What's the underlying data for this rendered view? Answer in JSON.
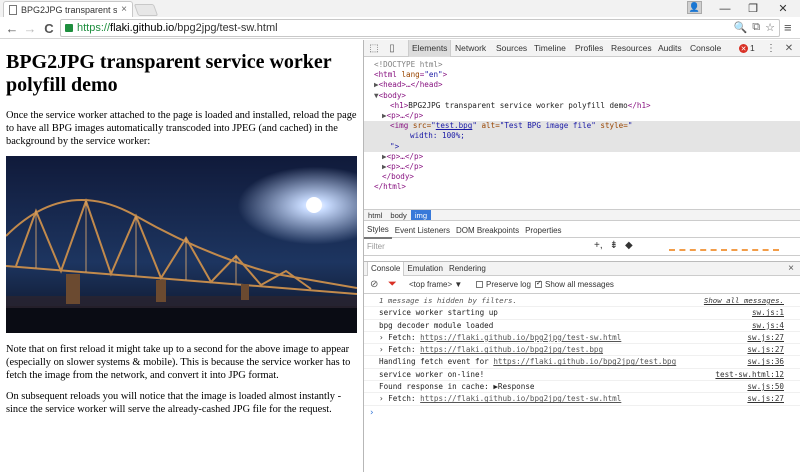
{
  "browser": {
    "tab_title": "BPG2JPG transparent serv",
    "tab_close": "×",
    "url_scheme": "https://",
    "url_host": "flaki.github.io",
    "url_path": "/bpg2jpg/test-sw.html",
    "nav": {
      "back": "←",
      "forward": "→",
      "reload": "C"
    },
    "window": {
      "minimize": "—",
      "maximize": "❐",
      "close": "✕"
    }
  },
  "page": {
    "heading": "BPG2JPG transparent service worker polyfill demo",
    "para1": "Once the service worker attached to the page is loaded and installed, reload the page to have all BPG images automatically transcoded into JPEG (and cached) in the background by the service worker:",
    "para2": "Note that on first reload it might take up to a second for the above image to appear (especially on slower systems & mobile). This is because the service worker has to fetch the image from the network, and convert it into JPG format.",
    "para3": "On subsequent reloads you will notice that the image is loaded almost instantly - since the service worker will serve the already-cashed JPG file for the request."
  },
  "devtools": {
    "tabs": [
      "Elements",
      "Network",
      "Sources",
      "Timeline",
      "Profiles",
      "Resources",
      "Audits",
      "Console"
    ],
    "active_tab": "Elements",
    "error_count": "1",
    "dom": {
      "doctype": "<!DOCTYPE html>",
      "html_open": "<html",
      "lang_attr": "lang",
      "lang_val": "\"en\"",
      "html_close_bracket": ">",
      "head": "<head>…</head>",
      "body_open": "<body>",
      "h1_open": "<h1>",
      "h1_text": "BPG2JPG transparent service worker polyfill demo",
      "h1_close": "</h1>",
      "p_collapsed": "<p>…</p>",
      "img_open": "<img",
      "src_attr": "src=",
      "src_val": "test.bpg",
      "alt_attr": "alt=",
      "alt_val": "\"Test BPG image file\"",
      "style_attr": "style=",
      "style_q": "\"",
      "style_val": "width: 100%;",
      "style_end": "\">",
      "body_close": "</body>",
      "html_close": "</html>"
    },
    "breadcrumbs": [
      "html",
      "body",
      "img"
    ],
    "style_tabs": [
      "Styles",
      "Event Listeners",
      "DOM Breakpoints",
      "Properties"
    ],
    "filter_placeholder": "Filter",
    "filter_icons": {
      "add": "+,",
      "pin": "⇟",
      "toggle": "◆"
    },
    "console_tabs": [
      "Console",
      "Emulation",
      "Rendering"
    ],
    "console_close": "×",
    "frame": "<top frame>",
    "preserve_log": "Preserve log",
    "show_all": "Show all messages",
    "hidden_msg": "1 message is hidden by filters.",
    "show_all_link": "Show all messages.",
    "messages": [
      {
        "text": "service worker starting up",
        "source": "sw.js:1"
      },
      {
        "text": "bpg decoder module loaded",
        "source": "sw.js:4"
      },
      {
        "prefix": "› Fetch:",
        "url": "https://flaki.github.io/bpg2jpg/test-sw.html",
        "source": "sw.js:27"
      },
      {
        "prefix": "› Fetch:",
        "url": "https://flaki.github.io/bpg2jpg/test.bpg",
        "source": "sw.js:27"
      },
      {
        "prefix": "Handling fetch event for",
        "url": "https://flaki.github.io/bpg2jpg/test.bpg",
        "source": "sw.js:36"
      },
      {
        "text": "service worker on-line!",
        "source": "test-sw.html:12"
      },
      {
        "prefix": "Found response in cache:",
        "url": "▶Response",
        "source": "sw.js:50"
      },
      {
        "prefix": "› Fetch:",
        "url": "https://flaki.github.io/bpg2jpg/test-sw.html",
        "source": "sw.js:27"
      }
    ],
    "prompt": "›"
  }
}
